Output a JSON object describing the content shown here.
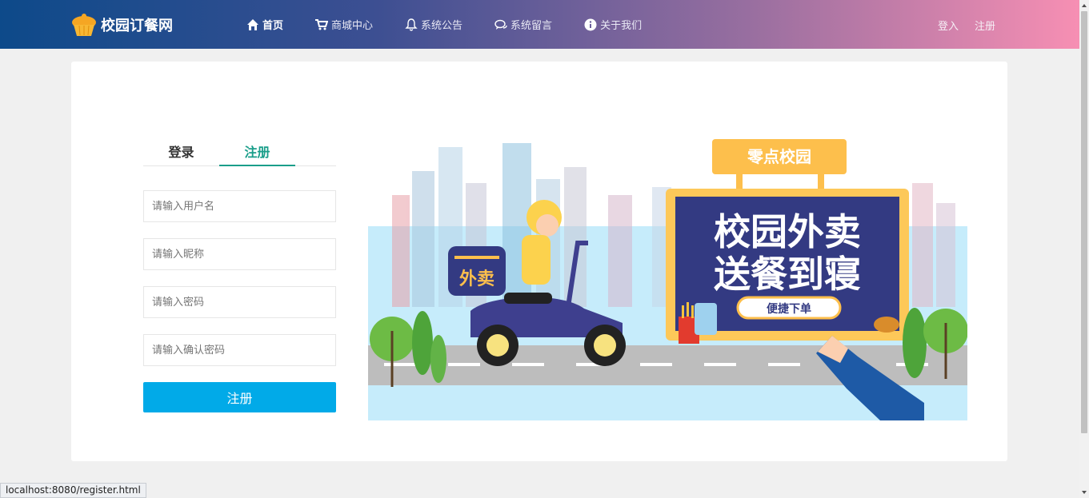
{
  "navbar": {
    "brand": "校园订餐网",
    "items": [
      {
        "label": "首页",
        "icon": "home-icon",
        "active": true
      },
      {
        "label": "商城中心",
        "icon": "cart-icon"
      },
      {
        "label": "系统公告",
        "icon": "bell-icon"
      },
      {
        "label": "系统留言",
        "icon": "comments-icon"
      },
      {
        "label": "关于我们",
        "icon": "info-icon"
      }
    ],
    "login": "登入",
    "register": "注册"
  },
  "form": {
    "tabs": [
      {
        "label": "登录",
        "active": false
      },
      {
        "label": "注册",
        "active": true
      }
    ],
    "username_placeholder": "请输入用户名",
    "nickname_placeholder": "请输入昵称",
    "password_placeholder": "请输入密码",
    "confirm_placeholder": "请输入确认密码",
    "submit_label": "注册"
  },
  "banner": {
    "sign_top": "零点校园",
    "line1": "校园外卖",
    "line2": "送餐到寝",
    "button": "便捷下单",
    "box_label": "外卖"
  },
  "status_url": "localhost:8080/register.html",
  "colors": {
    "accent": "#1a9e8a",
    "button": "#01aae8",
    "nav_start": "#0d4a8a",
    "nav_end": "#f78fb3"
  }
}
